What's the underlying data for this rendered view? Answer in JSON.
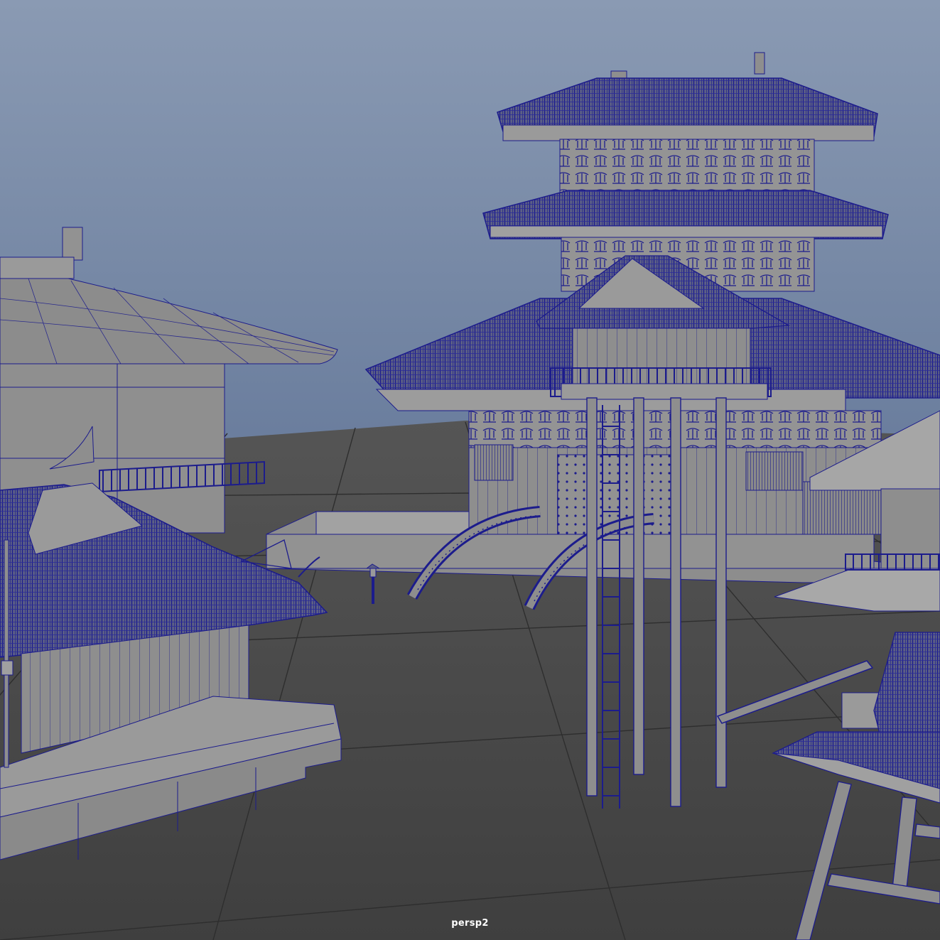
{
  "viewport": {
    "camera_name": "persp2",
    "colors": {
      "sky_top": "#8a9ab3",
      "sky_bottom": "#5f6f8a",
      "ground": "#4b4b4b",
      "grid_line": "#2e2e2e",
      "mesh_gray": "#8c8c8c",
      "mesh_light": "#9a9a9a",
      "mesh_dark": "#6e6e6e",
      "wireframe": "#1c1c8c"
    },
    "scene_objects": [
      {
        "id": "pagoda-tower",
        "icon": "pagoda-icon"
      },
      {
        "id": "main-hall",
        "icon": "temple-icon"
      },
      {
        "id": "left-pavilion",
        "icon": "pavilion-icon"
      },
      {
        "id": "foreground-hall",
        "icon": "temple-icon"
      },
      {
        "id": "watchtower",
        "icon": "watchtower-icon"
      },
      {
        "id": "arched-bridges",
        "icon": "bridge-icon"
      },
      {
        "id": "stone-lantern",
        "icon": "lantern-icon"
      },
      {
        "id": "right-gate",
        "icon": "gate-icon"
      }
    ]
  }
}
